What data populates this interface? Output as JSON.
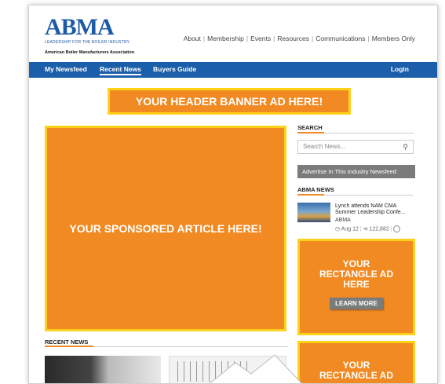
{
  "logo": {
    "word": "ABMA",
    "tagline": "LEADERSHIP FOR THE BOILER INDUSTRY",
    "subtitle": "American Boiler Manufacturers Association"
  },
  "top_links": [
    "About",
    "Membership",
    "Events",
    "Resources",
    "Communications",
    "Members Only"
  ],
  "nav": {
    "items": [
      "My Newsfeed",
      "Recent News",
      "Buyers Guide"
    ],
    "active": "Recent News",
    "login": "Login"
  },
  "header_ad": "YOUR HEADER BANNER AD HERE!",
  "sponsored_ad": "YOUR SPONSORED ARTICLE HERE!",
  "recent_news": {
    "title": "RECENT NEWS"
  },
  "sidebar": {
    "search_title": "SEARCH",
    "search_placeholder": "Search News...",
    "advertise_label": "Advertise In This Industry Newsfeed",
    "news_title": "ABMA NEWS",
    "news_item": {
      "headline": "Lynch attends NAM CMA Summer Leadership Confe...",
      "source": "ABMA",
      "date": "Aug 12",
      "shares": "122,882"
    },
    "rect_ad_1": {
      "line1": "YOUR",
      "line2": "RECTANGLE AD",
      "line3": "HERE",
      "button": "LEARN MORE"
    },
    "rect_ad_2": {
      "line1": "YOUR",
      "line2": "RECTANGLE AD"
    }
  },
  "colors": {
    "brand_blue": "#1b5ea9",
    "ad_orange": "#f28a23",
    "ad_border": "#ffd21a"
  }
}
